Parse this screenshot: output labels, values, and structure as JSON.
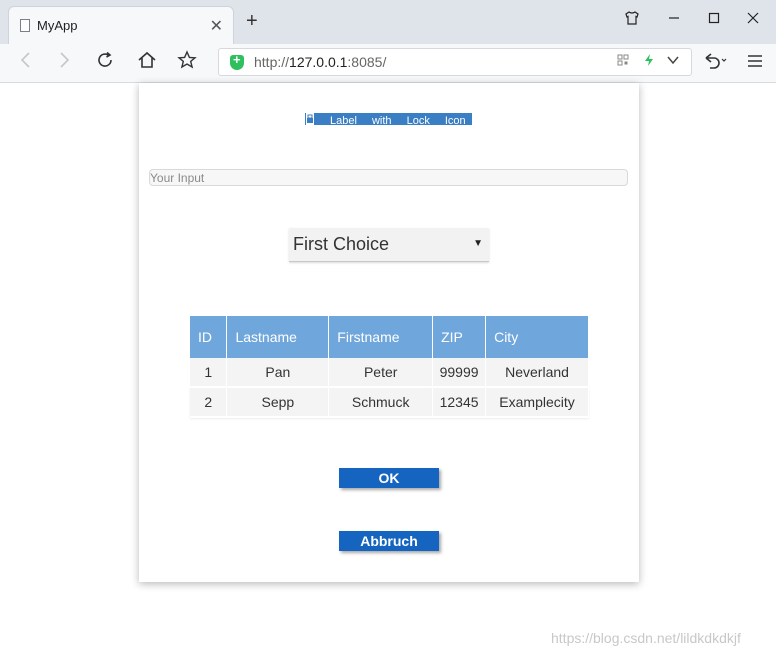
{
  "browser": {
    "tab": {
      "title": "MyApp",
      "close_glyph": "✕"
    },
    "new_tab_glyph": "+",
    "url": {
      "scheme": "http://",
      "host": "127.0.0.1",
      "rest": ":8085/"
    },
    "icons": [
      "page-icon",
      "close-icon",
      "plus-icon",
      "shirt-icon",
      "minimize-icon",
      "maximize-icon",
      "window-close-icon",
      "back-icon",
      "forward-icon",
      "reload-icon",
      "home-icon",
      "star-icon",
      "shield-icon",
      "qr-icon",
      "lightning-icon",
      "chevron-down-icon",
      "undo-icon",
      "menu-icon"
    ]
  },
  "app": {
    "lock_label": "Label with Lock Icon",
    "input": {
      "placeholder": "Your Input",
      "value": ""
    },
    "select": {
      "selected": "First Choice"
    },
    "table": {
      "headers": [
        "ID",
        "Lastname",
        "Firstname",
        "ZIP",
        "City"
      ],
      "rows": [
        [
          "1",
          "Pan",
          "Peter",
          "99999",
          "Neverland"
        ],
        [
          "2",
          "Sepp",
          "Schmuck",
          "12345",
          "Examplecity"
        ]
      ]
    },
    "ok_label": "OK",
    "cancel_label": "Abbruch"
  },
  "watermark": "https://blog.csdn.net/lildkdkdkjf",
  "colors": {
    "header_bg": "#6fa6dc",
    "button_bg": "#1565c0",
    "label_bg": "#3a7fc4"
  }
}
